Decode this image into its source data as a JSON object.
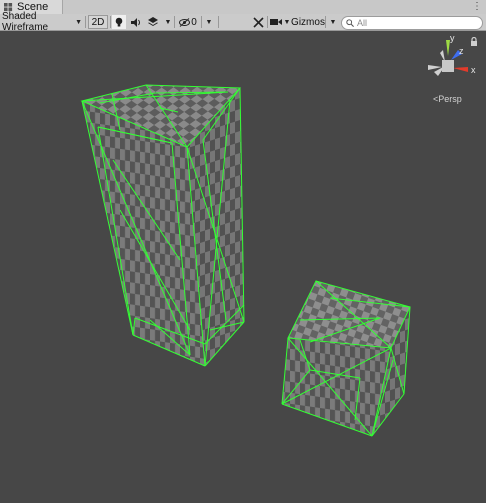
{
  "tab": {
    "title": "Scene"
  },
  "toolbar": {
    "draw_mode": "Shaded Wireframe",
    "mode_2d": "2D",
    "hidden_count": "0",
    "gizmos": "Gizmos",
    "search_placeholder": "All"
  },
  "gizmo": {
    "x": "x",
    "y": "y",
    "z": "z",
    "projection": "Persp"
  },
  "colors": {
    "wireframe": "#33ff33",
    "checker_light": "#8a8a8a",
    "checker_dark": "#5c5c5c",
    "background": "#474747"
  },
  "icons": [
    "scene-icon",
    "kebab-menu-icon",
    "maximize-icon",
    "close-icon",
    "lightbulb-icon",
    "speaker-icon",
    "effects-icon",
    "visibility-icon",
    "tools-icon",
    "camera-icon",
    "search-icon",
    "lock-icon"
  ]
}
